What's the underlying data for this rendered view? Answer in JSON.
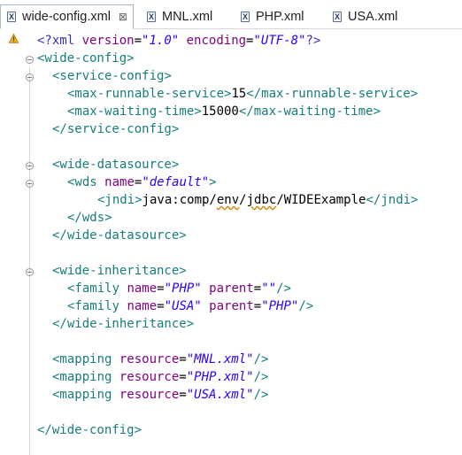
{
  "tabs": [
    {
      "label": "wide-config.xml",
      "active": true,
      "close": "⊠"
    },
    {
      "label": "MNL.xml",
      "active": false
    },
    {
      "label": "PHP.xml",
      "active": false
    },
    {
      "label": "USA.xml",
      "active": false
    }
  ],
  "code": {
    "l1": {
      "a": "<?xml ",
      "b": "version",
      "c": "=",
      "d": "\"1.0\"",
      "e": " encoding",
      "f": "=",
      "g": "\"UTF-8\"",
      "h": "?>"
    },
    "l2": {
      "a": "<wide-config>"
    },
    "l3": {
      "a": "<service-config>"
    },
    "l4": {
      "a": "<max-runnable-service>",
      "b": "15",
      "c": "</max-runnable-service>"
    },
    "l5": {
      "a": "<max-waiting-time>",
      "b": "15000",
      "c": "</max-waiting-time>"
    },
    "l6": {
      "a": "</service-config>"
    },
    "l8": {
      "a": "<wide-datasource>"
    },
    "l9": {
      "a": "<wds ",
      "b": "name",
      "c": "=",
      "d": "\"default\"",
      "e": ">"
    },
    "l10": {
      "a": "<jndi>",
      "b1": "java:comp/",
      "b2": "env",
      "b3": "/",
      "b4": "jdbc",
      "b5": "/WIDEExample",
      "c": "</jndi>"
    },
    "l11": {
      "a": "</wds>"
    },
    "l12": {
      "a": "</wide-datasource>"
    },
    "l14": {
      "a": "<wide-inheritance>"
    },
    "l15": {
      "a": "<family ",
      "b": "name",
      "c": "=",
      "d": "\"PHP\"",
      "e": " parent",
      "f": "=",
      "g": "\"\"",
      "h": "/>"
    },
    "l16": {
      "a": "<family ",
      "b": "name",
      "c": "=",
      "d": "\"USA\"",
      "e": " parent",
      "f": "=",
      "g": "\"PHP\"",
      "h": "/>"
    },
    "l17": {
      "a": "</wide-inheritance>"
    },
    "l19": {
      "a": "<mapping ",
      "b": "resource",
      "c": "=",
      "d": "\"MNL.xml\"",
      "e": "/>"
    },
    "l20": {
      "a": "<mapping ",
      "b": "resource",
      "c": "=",
      "d": "\"PHP.xml\"",
      "e": "/>"
    },
    "l21": {
      "a": "<mapping ",
      "b": "resource",
      "c": "=",
      "d": "\"USA.xml\"",
      "e": "/>"
    },
    "l23": {
      "a": "</wide-config>"
    }
  },
  "colors": {
    "tag": "#177c7c",
    "attribute": "#7f007f",
    "attribute_value": "#2a00ff",
    "warning": "#f2b01e"
  }
}
